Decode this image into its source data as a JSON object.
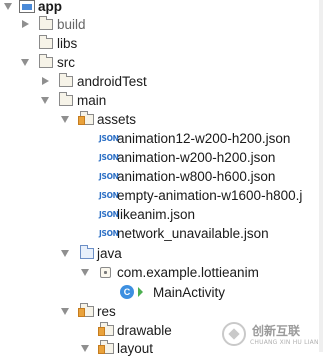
{
  "tree": {
    "app": "app",
    "build": "build",
    "libs": "libs",
    "src": "src",
    "androidTest": "androidTest",
    "main": "main",
    "assets": "assets",
    "files": [
      "animation12-w200-h200.json",
      "animation-w200-h200.json",
      "animation-w800-h600.json",
      "empty-animation-w1600-h800.j",
      "likeanim.json",
      "network_unavailable.json"
    ],
    "java": "java",
    "package": "com.example.lottieanim",
    "class": "MainActivity",
    "res": "res",
    "drawable": "drawable",
    "layout": "layout"
  },
  "icons": {
    "json_glyph": "JSON",
    "class_glyph": "C"
  },
  "watermark": {
    "title": "创新互联",
    "subtitle": "CHUANG XIN HU LIAN"
  }
}
